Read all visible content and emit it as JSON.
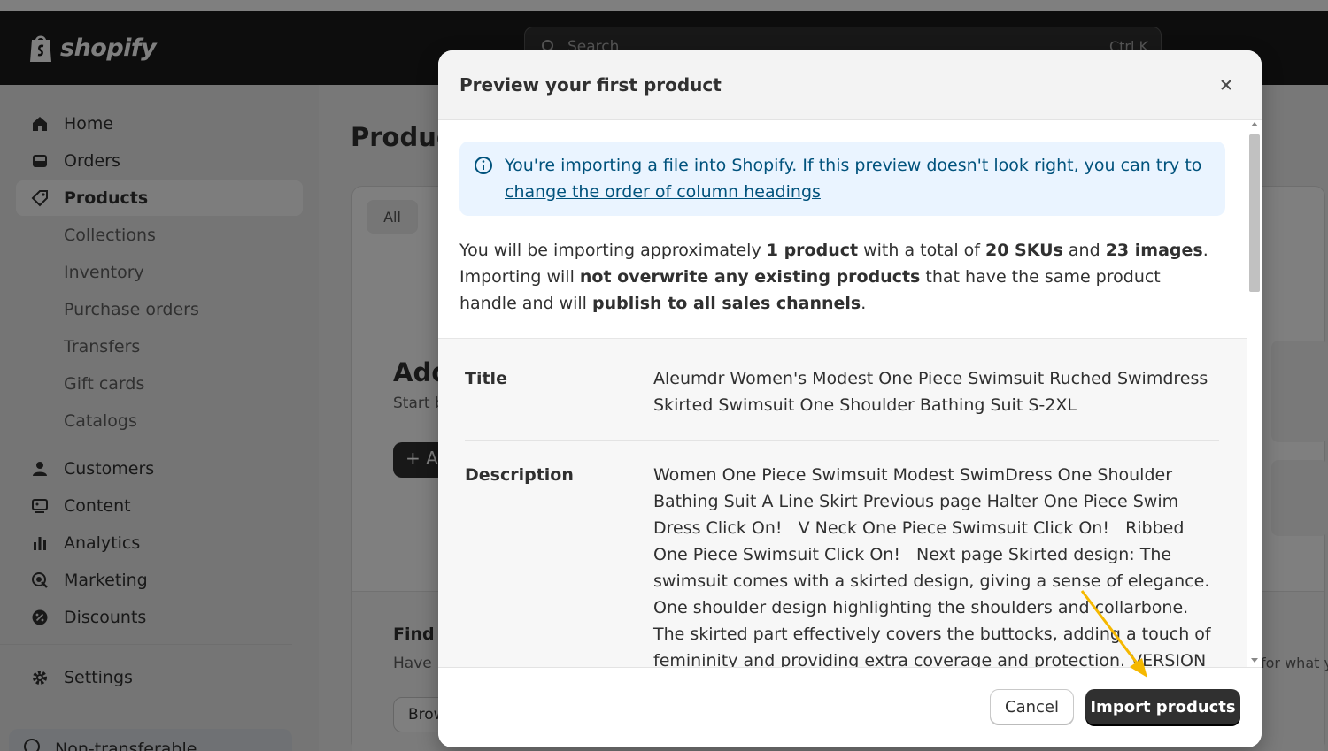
{
  "topbar": {
    "logo_text": "shopify",
    "search_placeholder": "Search",
    "search_shortcut": "Ctrl K"
  },
  "sidebar": {
    "items": [
      {
        "label": "Home",
        "icon": "home-icon"
      },
      {
        "label": "Orders",
        "icon": "inbox-icon"
      },
      {
        "label": "Products",
        "icon": "tag-icon",
        "active": true
      },
      {
        "label": "Collections"
      },
      {
        "label": "Inventory"
      },
      {
        "label": "Purchase orders"
      },
      {
        "label": "Transfers"
      },
      {
        "label": "Gift cards"
      },
      {
        "label": "Catalogs"
      },
      {
        "label": "Customers",
        "icon": "person-icon"
      },
      {
        "label": "Content",
        "icon": "content-icon"
      },
      {
        "label": "Analytics",
        "icon": "bar-chart-icon"
      },
      {
        "label": "Marketing",
        "icon": "target-icon"
      },
      {
        "label": "Discounts",
        "icon": "discount-icon"
      },
      {
        "label": "Settings",
        "icon": "gear-icon"
      }
    ],
    "bottom_label": "Non-transferable"
  },
  "main": {
    "page_title": "Produc",
    "tab_all": "All",
    "add_heading": "Add",
    "add_sub": "Start b",
    "add_button": "+ A",
    "find_heading": "Find",
    "find_sub": "Have",
    "browse_button": "Brow",
    "right_fragment": "for what y"
  },
  "modal": {
    "title": "Preview your first product",
    "banner_text": "You're importing a file into Shopify. If this preview doesn't look right, you can try to",
    "banner_link": "change the order of column headings",
    "summary": {
      "p1": "You will be importing approximately ",
      "b1": "1 product",
      "p2": " with a total of ",
      "b2": "20 SKUs",
      "p3": " and ",
      "b3": "23 images",
      "p4": ". Importing will ",
      "b4": "not overwrite any existing products",
      "p5": " that have the same product handle and will ",
      "b5": "publish to all sales channels",
      "p6": "."
    },
    "rows": [
      {
        "label": "Title",
        "value": "Aleumdr Women's Modest One Piece Swimsuit Ruched Swimdress Skirted Swimsuit One Shoulder Bathing Suit S-2XL"
      },
      {
        "label": "Description",
        "value": "Women One Piece Swimsuit Modest SwimDress One Shoulder Bathing Suit A Line Skirt Previous page Halter One Piece Swim Dress Click On!   V Neck One Piece Swimsuit Click On!   Ribbed One Piece Swimsuit Click On!   Next page Skirted design: The swimsuit comes with a skirted design, giving a sense of elegance. One shoulder design highlighting the shoulders and collarbone. The skirted part effectively covers the buttocks, adding a touch of femininity and providing extra coverage and protection. VERSION UPDATE PROMPT"
      }
    ],
    "cancel_label": "Cancel",
    "import_label": "Import products"
  },
  "colors": {
    "topbar": "#1a1a1a",
    "banner_bg": "#eaf4ff",
    "banner_text": "#00527c",
    "primary_button": "#303030",
    "annotation_arrow": "#f5b800"
  }
}
